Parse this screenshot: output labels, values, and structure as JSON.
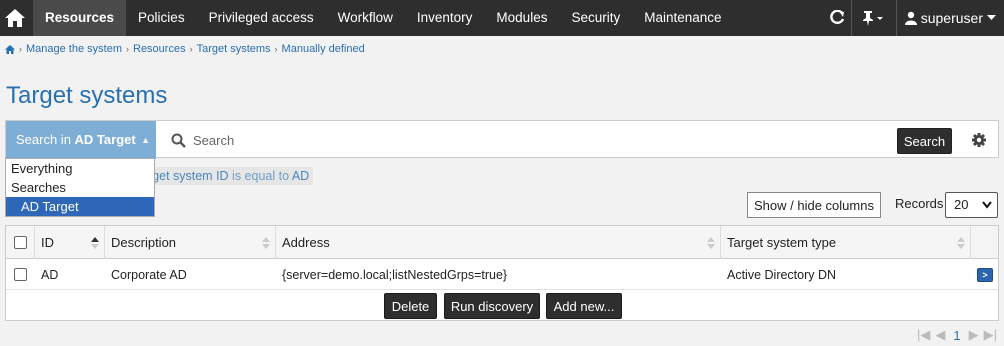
{
  "nav": {
    "items": [
      "Resources",
      "Policies",
      "Privileged access",
      "Workflow",
      "Inventory",
      "Modules",
      "Security",
      "Maintenance"
    ],
    "active": "Resources",
    "user": "superuser",
    "icons": [
      "home-icon",
      "refresh-icon",
      "pin-icon",
      "user-icon"
    ]
  },
  "breadcrumb": [
    "Manage the system",
    "Resources",
    "Target systems",
    "Manually defined"
  ],
  "page_title": "Target systems",
  "search": {
    "scope_prefix": "Search in ",
    "scope_value": "AD Target",
    "placeholder": "Search",
    "button": "Search"
  },
  "dropdown": {
    "items": [
      "Everything",
      "Searches",
      "AD Target"
    ],
    "selected": "AD Target"
  },
  "filter": {
    "field": "rget system ID",
    "op": " is equal to ",
    "value": "AD"
  },
  "table_controls": {
    "show_hide": "Show / hide columns",
    "records_label": "Records",
    "records_value": "20"
  },
  "table": {
    "columns": [
      "ID",
      "Description",
      "Address",
      "Target system type"
    ],
    "rows": [
      {
        "id": "AD",
        "description": "Corporate AD",
        "address": "{server=demo.local;listNestedGrps=true}",
        "type": "Active Directory DN"
      }
    ]
  },
  "actions": [
    "Delete",
    "Run discovery",
    "Add new..."
  ],
  "pager": {
    "current": "1"
  },
  "colors": {
    "nav_bg": "#2e2e2e",
    "accent": "#2a6fb0",
    "scope_bg": "#7eaed6",
    "selected": "#2f67b8"
  }
}
